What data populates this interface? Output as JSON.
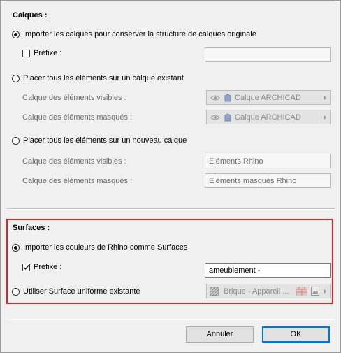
{
  "layers": {
    "title": "Calques :",
    "option_import": "Importer les calques pour conserver la structure de calques originale",
    "prefix_label": "Préfixe :",
    "prefix_value": "",
    "option_existing": "Placer tous les éléments sur un calque existant",
    "visible_label": "Calque des éléments visibles :",
    "visible_value": "Calque ARCHICAD",
    "hidden_label": "Calque des éléments masqués :",
    "hidden_value": "Calque ARCHICAD",
    "option_new": "Placer tous les éléments sur un nouveau calque",
    "new_visible_label": "Calque des éléments visibles :",
    "new_visible_value": "Eléments Rhino",
    "new_hidden_label": "Calque des éléments masqués :",
    "new_hidden_value": "Eléments masqués Rhino",
    "selected_option": "import"
  },
  "surfaces": {
    "title": "Surfaces :",
    "option_import_colors": "Importer les couleurs de Rhino comme Surfaces",
    "prefix_label": "Préfixe :",
    "prefix_checked": true,
    "prefix_value": "ameublement -",
    "option_uniform": "Utiliser Surface uniforme existante",
    "uniform_value": "Brique - Appareil ...",
    "selected_option": "import_colors"
  },
  "buttons": {
    "cancel": "Annuler",
    "ok": "OK"
  },
  "colors": {
    "highlight": "#e4202a",
    "ok_border": "#0078d7"
  }
}
